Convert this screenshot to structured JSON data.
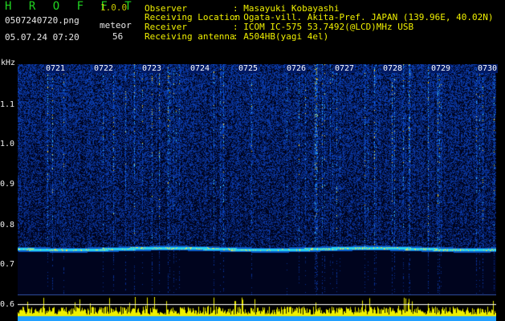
{
  "header": {
    "app_title": "H R O F F T",
    "version": "1.0.0",
    "filename": "0507240720.png",
    "datetime": "05.07.24 07:20",
    "meteor_label": "meteor",
    "meteor_count": "56"
  },
  "info": [
    {
      "label": "Observer",
      "value": ": Masayuki Kobayashi"
    },
    {
      "label": "Receiving Location",
      "value": ": Ogata-vill. Akita-Pref. JAPAN (139.96E, 40.02N)"
    },
    {
      "label": "Receiver",
      "value": ": ICOM IC-575 53.7492(@LCD)MHz USB"
    },
    {
      "label": "Receiving antenna",
      "value": ": A504HB(yagi 4el)"
    }
  ],
  "spectrogram": {
    "freq_unit": "kHz",
    "freq_ticks": [
      "1.1",
      "1.0",
      "0.9",
      "0.8",
      "0.7",
      "0.6"
    ],
    "time_ticks": [
      "0721",
      "0722",
      "0723",
      "0724",
      "0725",
      "0726",
      "0727",
      "0728",
      "0729",
      "0730"
    ],
    "carrier_freq_khz": 0.74,
    "colors": {
      "background": "#00062a",
      "noise": "#1030c0",
      "hot": "#ffd000",
      "carrier": "#40e0ff"
    }
  },
  "level_graph": {
    "colors": {
      "fill": "#f0f000",
      "baseline": "#20a0ff"
    }
  }
}
